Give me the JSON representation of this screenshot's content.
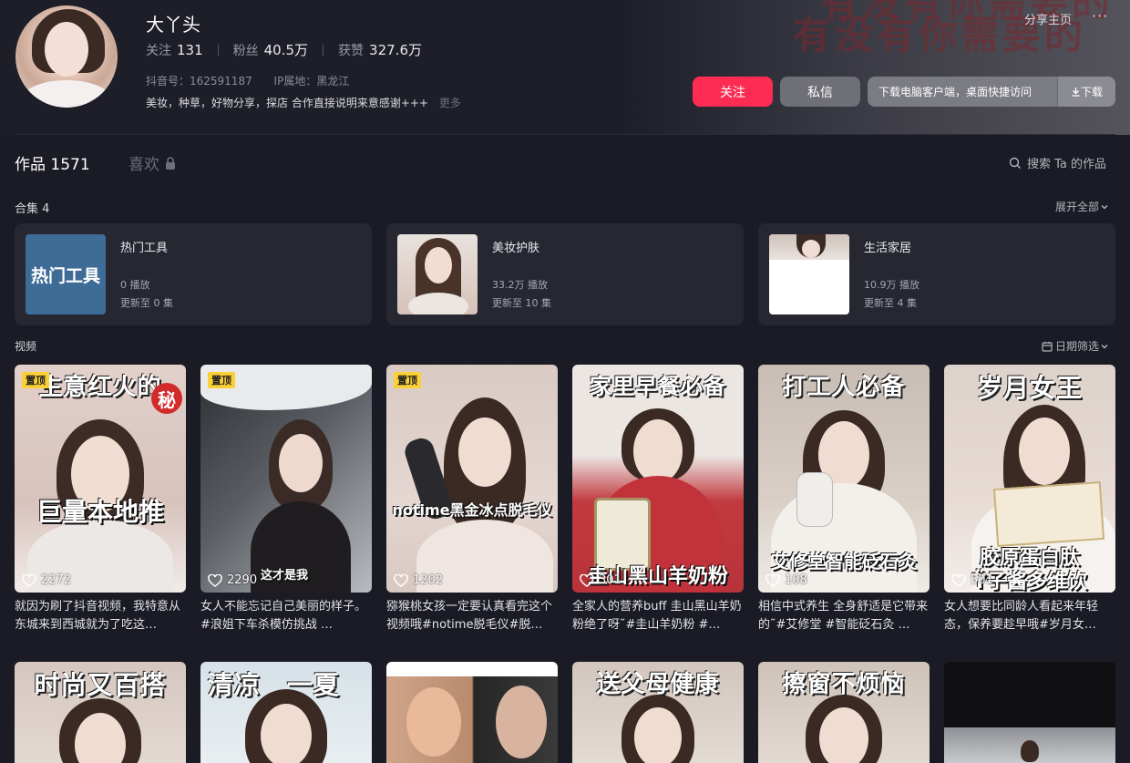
{
  "profile": {
    "nickname": "大丫头",
    "following_label": "关注",
    "following": "131",
    "followers_label": "粉丝",
    "followers": "40.5万",
    "likes_label": "获赞",
    "likes": "327.6万",
    "douyin_id": "抖音号：162591187",
    "ip_location": "IP属地：黑龙江",
    "bio": "美妆，种草，好物分享，探店 合作直接说明来意感谢+++",
    "bio_more": "更多"
  },
  "header": {
    "share_label": "分享主页",
    "more_label": "···",
    "banner_line1": "有没有你需要的",
    "banner_line2": "有没有你需要的"
  },
  "actions": {
    "follow_label": "关注",
    "message_label": "私信",
    "download_text": "下载电脑客户端，桌面快捷访问",
    "download_label": "下载"
  },
  "tabs": {
    "works_label": "作品 1571",
    "likes_label": "喜欢",
    "search_label": "搜索 Ta 的作品"
  },
  "collections": {
    "label": "合集 4",
    "expand_label": "展开全部",
    "items": [
      {
        "thumb_text": "热门工具",
        "title": "热门工具",
        "plays": "0 播放",
        "updated": "更新至 0 集"
      },
      {
        "title": "美妆护肤",
        "plays": "33.2万 播放",
        "updated": "更新至 10 集"
      },
      {
        "title": "生活家居",
        "plays": "10.9万 播放",
        "updated": "更新至 4 集"
      }
    ]
  },
  "videos": {
    "label": "视频",
    "date_filter_label": "日期筛选",
    "pinned_label": "置顶",
    "items": [
      {
        "pinned": true,
        "cap_top": "生意红火的",
        "cap_badge": "秘",
        "cap_mid": "巨量本地推",
        "likes": "2272",
        "desc": "就因为刷了抖音视频，我特意从东城来到西城就为了吃这…",
        "bg": "#d8c2bc"
      },
      {
        "pinned": true,
        "cap_top": "",
        "cap_mid": "这才是我",
        "likes": "2290",
        "desc": "女人不能忘记自己美丽的样子。#浪姐下车杀模仿挑战 …",
        "bg": "#5a5d63"
      },
      {
        "pinned": true,
        "cap_top": "",
        "cap_mid": "notime黑金冰点脱毛仪",
        "likes": "1202",
        "desc": "猕猴桃女孩一定要认真看完这个视频哦#notime脱毛仪#脱…",
        "bg": "#e4d6d0"
      },
      {
        "pinned": false,
        "cap_top": "家里早餐必备",
        "cap_mid": "圭山黑山羊奶粉",
        "likes": "301",
        "desc": "全家人的营养buff 圭山黑山羊奶粉绝了呀˜#圭山羊奶粉 #…",
        "bg": "#c13a3f"
      },
      {
        "pinned": false,
        "cap_top": "打工人必备",
        "cap_mid": "艾修堂智能砭石灸",
        "likes": "108",
        "desc": "相信中式养生 全身舒适是它带来的˜#艾修堂 #智能砭石灸 …",
        "bg": "#d9cfc6"
      },
      {
        "pinned": false,
        "cap_top": "岁月女王",
        "cap_mid": "胶原蛋白肽",
        "cap_mid2": "Ÿ子酱多维饮",
        "likes": "501",
        "desc": "女人想要比同龄人看起来年轻态，保养要趁早哦#岁月女…",
        "bg": "#e8dbd5"
      },
      {
        "cap_top": "时尚又百搭",
        "bg": "#d5c7c0"
      },
      {
        "cap_top": "清凉　一夏",
        "bg": "#d6e2e8"
      },
      {
        "cap_top": "",
        "bg": "#cfa58a"
      },
      {
        "cap_top": "送父母健康",
        "bg": "#d2c6be"
      },
      {
        "cap_top": "擦窗不烦恼",
        "bg": "#cfc3b9"
      },
      {
        "cap_top": "",
        "bg": "#101012"
      }
    ]
  },
  "colors": {
    "accent": "#fe2c55",
    "background": "#1a1b24",
    "card": "#262731",
    "pin": "#fbd034"
  }
}
